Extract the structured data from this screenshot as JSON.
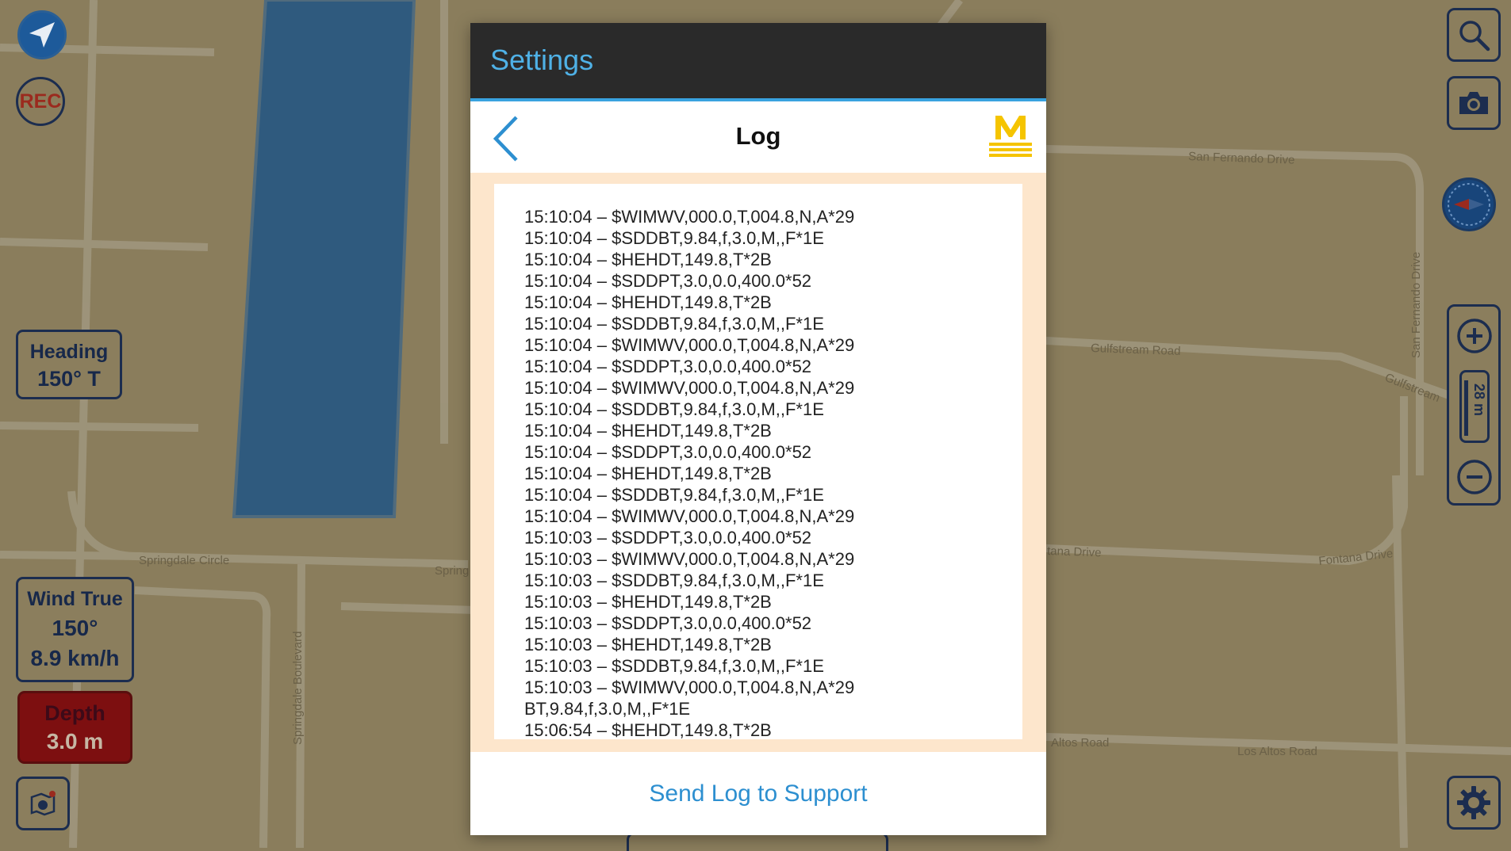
{
  "map": {
    "road_labels": [
      "Springdale Circle",
      "Spring",
      "Springdale Boulevard",
      "San Fernando Drive",
      "Gulfstream Road",
      "Gulfstream",
      "San Fernando Drive",
      "tana Drive",
      "Fontana Drive",
      "Altos Road",
      "Los Altos Road"
    ]
  },
  "left_controls": {
    "rec_label": "REC",
    "heading": {
      "label": "Heading",
      "value": "150° T"
    },
    "wind": {
      "label": "Wind True",
      "direction": "150°",
      "speed": "8.9 km/h"
    },
    "depth": {
      "label": "Depth",
      "value": "3.0 m"
    }
  },
  "right_controls": {
    "scale_label": "28 m"
  },
  "dialog": {
    "title": "Settings",
    "log_title": "Log",
    "log_lines": [
      "15:10:04 – $WIMWV,000.0,T,004.8,N,A*29",
      "15:10:04 – $SDDBT,9.84,f,3.0,M,,F*1E",
      "15:10:04 – $HEHDT,149.8,T*2B",
      "15:10:04 – $SDDPT,3.0,0.0,400.0*52",
      "15:10:04 – $HEHDT,149.8,T*2B",
      "15:10:04 – $SDDBT,9.84,f,3.0,M,,F*1E",
      "15:10:04 – $WIMWV,000.0,T,004.8,N,A*29",
      "15:10:04 – $SDDPT,3.0,0.0,400.0*52",
      "15:10:04 – $WIMWV,000.0,T,004.8,N,A*29",
      "15:10:04 – $SDDBT,9.84,f,3.0,M,,F*1E",
      "15:10:04 – $HEHDT,149.8,T*2B",
      "15:10:04 – $SDDPT,3.0,0.0,400.0*52",
      "15:10:04 – $HEHDT,149.8,T*2B",
      "15:10:04 – $SDDBT,9.84,f,3.0,M,,F*1E",
      "15:10:04 – $WIMWV,000.0,T,004.8,N,A*29",
      "15:10:03 – $SDDPT,3.0,0.0,400.0*52",
      "15:10:03 – $WIMWV,000.0,T,004.8,N,A*29",
      "15:10:03 – $SDDBT,9.84,f,3.0,M,,F*1E",
      "15:10:03 – $HEHDT,149.8,T*2B",
      "15:10:03 – $SDDPT,3.0,0.0,400.0*52",
      "15:10:03 – $HEHDT,149.8,T*2B",
      "15:10:03 – $SDDBT,9.84,f,3.0,M,,F*1E",
      "15:10:03 – $WIMWV,000.0,T,004.8,N,A*29",
      "BT,9.84,f,3.0,M,,F*1E",
      "15:06:54 – $HEHDT,149.8,T*2B"
    ],
    "send_button": "Send Log to Support"
  },
  "icons": {
    "navigate": "navigation-arrow-icon",
    "back": "chevron-left-icon",
    "logo": "m-logo-icon",
    "search": "search-icon",
    "camera": "camera-icon",
    "compass": "compass-icon",
    "zoom_in": "zoom-in-icon",
    "zoom_out": "zoom-out-icon",
    "settings": "gear-icon",
    "layers": "layers-icon"
  },
  "colors": {
    "title_bar": "#2a2a2a",
    "title_text": "#4fb1e6",
    "accent": "#39a2df",
    "log_background": "#fde6cc",
    "send_button_text": "#2d8fd0",
    "logo": "#f5c400",
    "depth_alarm": "#7d0f10"
  }
}
